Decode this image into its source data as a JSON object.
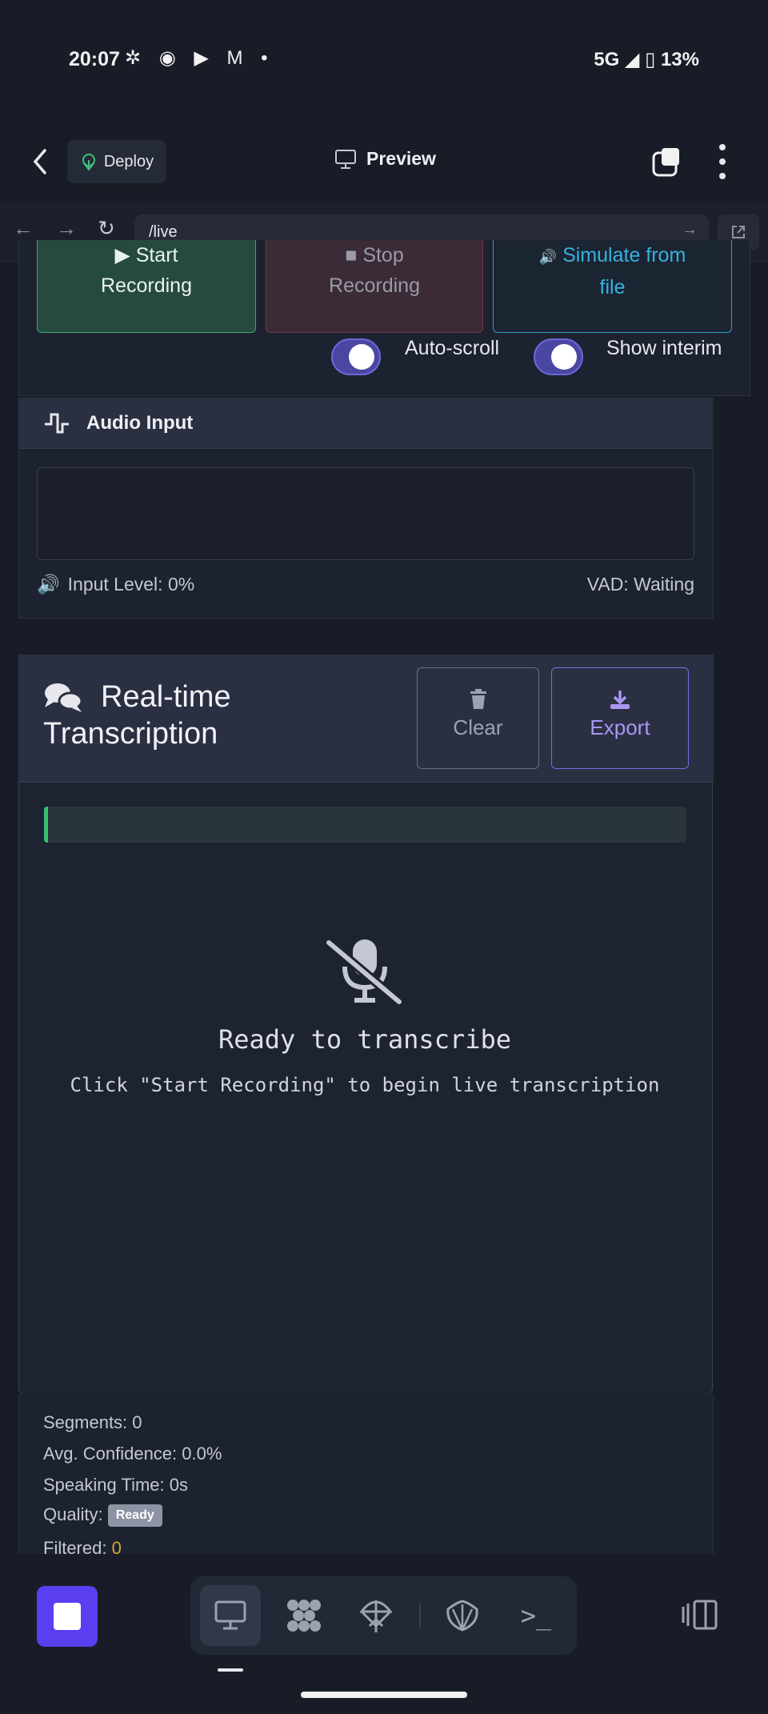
{
  "status_bar": {
    "time": "20:07",
    "network": "5G",
    "battery": "13%"
  },
  "app_header": {
    "deploy_label": "Deploy",
    "title": "Preview"
  },
  "url_bar": {
    "url": "/live"
  },
  "controls": {
    "start_label_1": "Start",
    "start_label_2": "Recording",
    "stop_label_1": "Stop",
    "stop_label_2": "Recording",
    "simulate_label_1": "Simulate from",
    "simulate_label_2": "file",
    "autoscroll_label": "Auto-scroll",
    "interim_label": "Show interim",
    "autoscroll_on": true,
    "interim_on": true
  },
  "audio_input": {
    "title": "Audio Input",
    "level_text": "Input Level: 0%",
    "vad_text": "VAD: Waiting"
  },
  "transcription": {
    "title_line1": "Real-time",
    "title_line2": "Transcription",
    "clear_label": "Clear",
    "export_label": "Export",
    "empty_title": "Ready to transcribe",
    "empty_subtitle": "Click \"Start Recording\" to begin live transcription"
  },
  "stats": {
    "segments": "Segments: 0",
    "avg_confidence": "Avg. Confidence: 0.0%",
    "speaking_time": "Speaking Time: 0s",
    "quality_label": "Quality:",
    "quality_badge": "Ready",
    "filtered_label": "Filtered:",
    "filtered_value": "0"
  },
  "colors": {
    "accent_purple": "#5a3ff0",
    "start_green": "#3fa86f",
    "simulate_blue": "#34b2e0",
    "export_purple": "#a996f5"
  },
  "icons": {
    "dock": [
      "monitor-icon",
      "mesh-icon",
      "parachute-icon",
      "shell-icon",
      "terminal-icon"
    ]
  }
}
